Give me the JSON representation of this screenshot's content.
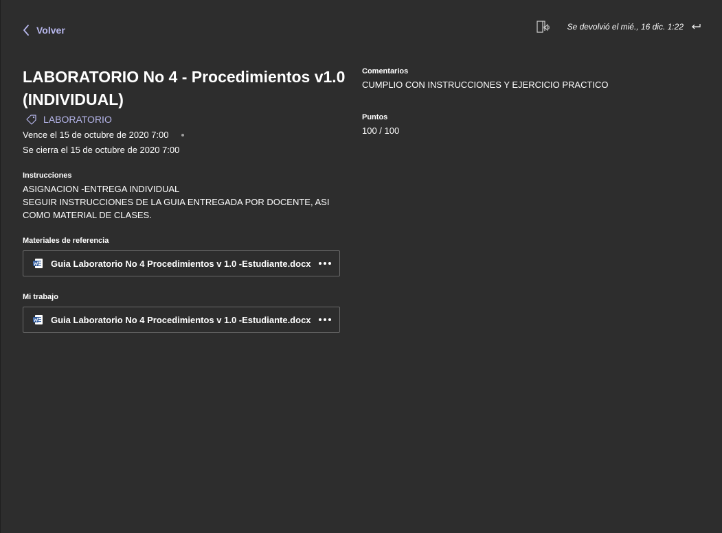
{
  "nav": {
    "back_label": "Volver"
  },
  "header": {
    "returned_text": "Se devolvió el mié., 16 dic. 1:22"
  },
  "assignment": {
    "title": "LABORATORIO No 4 - Procedimientos v1.0 (INDIVIDUAL)",
    "tag": "LABORATORIO",
    "due": "Vence el 15 de octubre de 2020 7:00",
    "closes": "Se cierra el 15 de octubre de 2020 7:00",
    "instructions_label": "Instrucciones",
    "instructions": "ASIGNACION -ENTREGA INDIVIDUAL\nSEGUIR INSTRUCCIONES DE LA GUIA ENTREGADA POR DOCENTE, ASI COMO MATERIAL DE CLASES.",
    "reference_label": "Materiales de referencia",
    "reference_file": "Guia Laboratorio No 4 Procedimientos v 1.0 -Estudiante.docx",
    "my_work_label": "Mi trabajo",
    "my_work_file": "Guia Laboratorio No 4 Procedimientos v 1.0 -Estudiante.docx"
  },
  "feedback": {
    "comments_label": "Comentarios",
    "comments": "CUMPLIO CON INSTRUCCIONES Y EJERCICIO PRACTICO",
    "points_label": "Puntos",
    "points": "100 / 100"
  },
  "colors": {
    "background": "#2d2d2d",
    "accent": "#b7b7ec",
    "word_blue": "#2b579a",
    "border": "#6a6a6a"
  },
  "icons": [
    "chevron-left-icon",
    "immersive-reader-icon",
    "return-arrow-icon",
    "tag-icon",
    "word-file-icon",
    "more-options-icon"
  ]
}
